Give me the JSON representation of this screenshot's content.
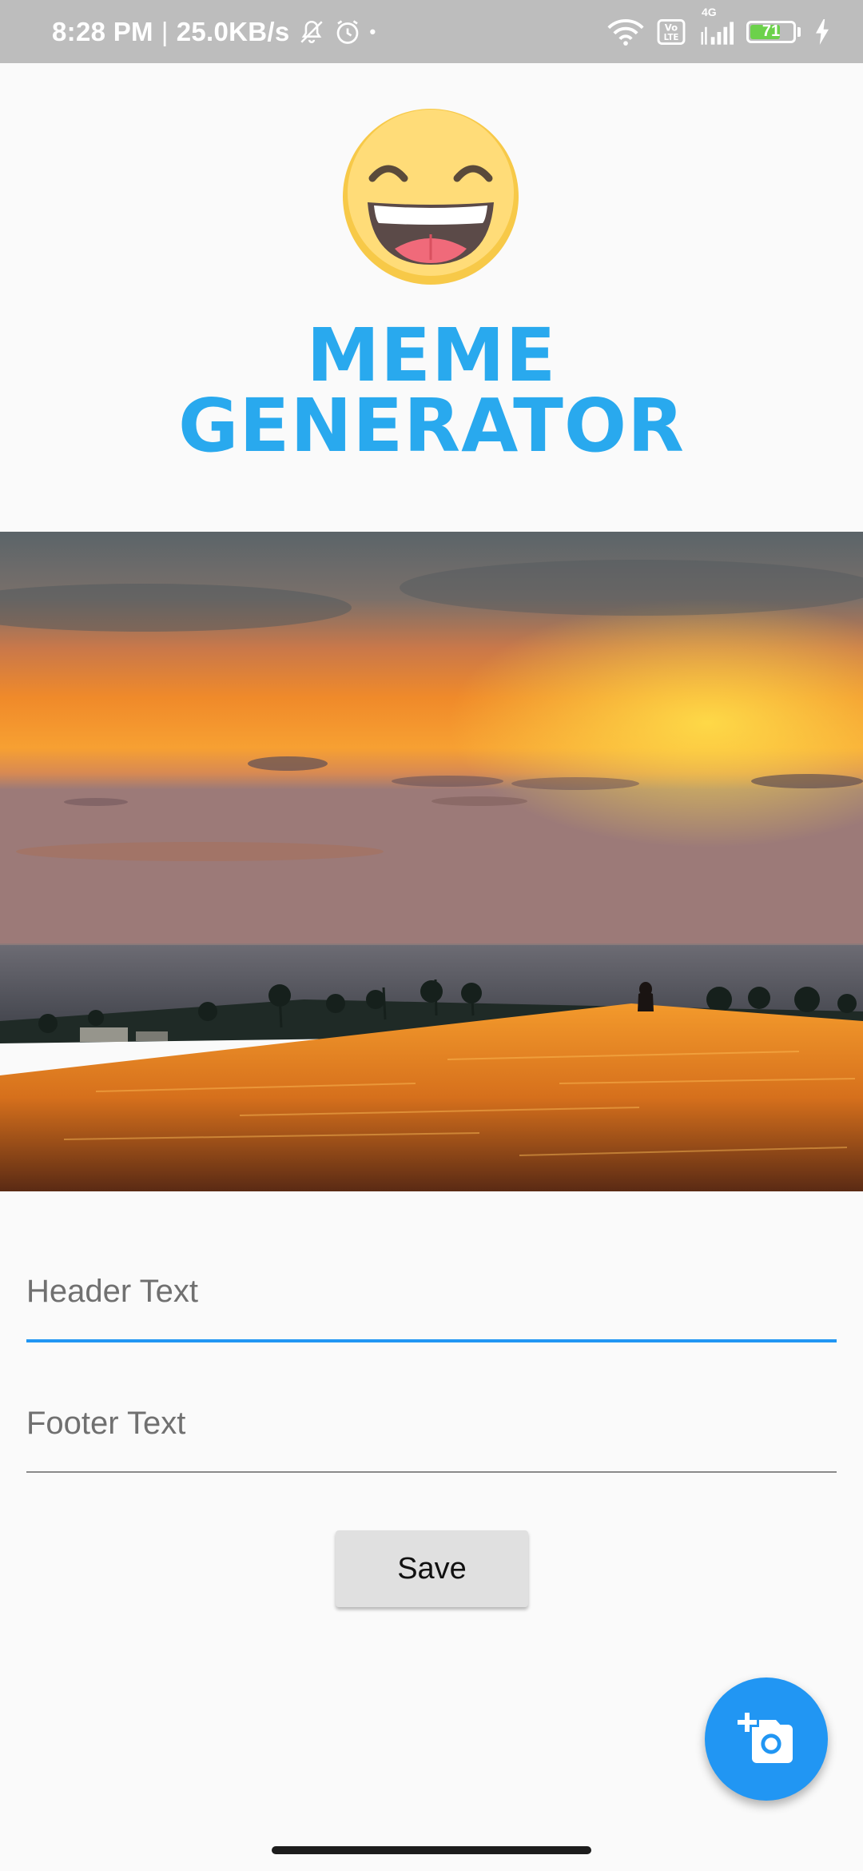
{
  "status_bar": {
    "time": "8:28 PM",
    "separator": "|",
    "speed": "25.0KB/s",
    "network": "4G",
    "volte": "Vo LTE",
    "battery_level": "71",
    "battery_fraction": 0.71,
    "icons": [
      "bell-off-icon",
      "alarm-icon",
      "wifi-icon",
      "volte-icon",
      "signal-icon",
      "battery-icon",
      "charging-icon"
    ]
  },
  "logo": {
    "line1": "MEME",
    "line2": "GENERATOR",
    "icon": "laughing-emoji-icon",
    "color": "#29a9ee"
  },
  "image": {
    "icon": "sunset-infinity-pool-photo"
  },
  "form": {
    "header_placeholder": "Header Text",
    "header_value": "",
    "footer_placeholder": "Footer Text",
    "footer_value": "",
    "save_label": "Save",
    "accent_color": "#2196f3"
  },
  "fab": {
    "icon": "add-photo-icon"
  }
}
